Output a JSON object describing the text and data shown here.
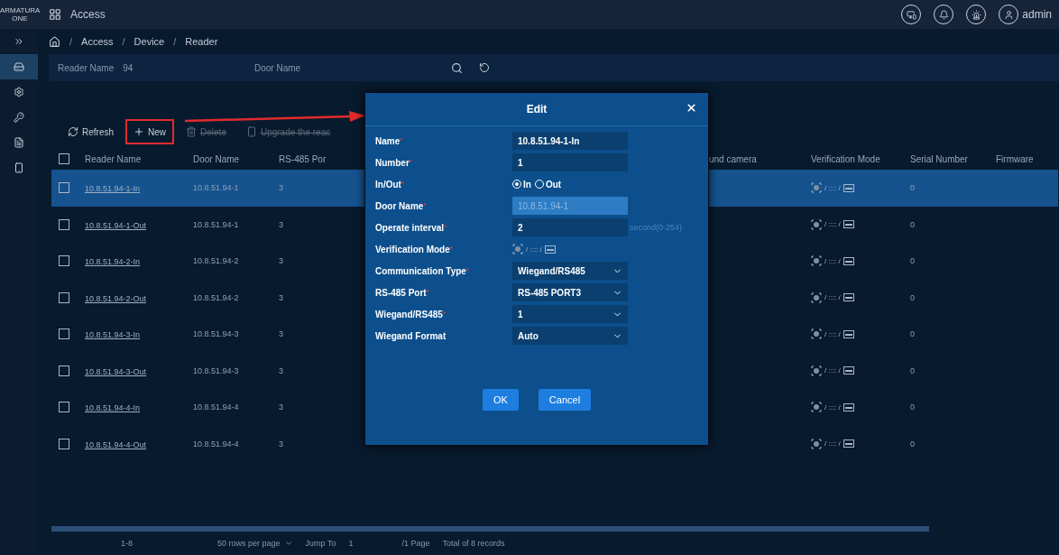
{
  "topbar": {
    "logo": "ARMATURA ONE",
    "app": "Access",
    "user": "admin"
  },
  "sidebar": [
    {
      "selected": false
    },
    {
      "selected": true
    },
    {
      "selected": false
    },
    {
      "selected": false
    },
    {
      "selected": false
    },
    {
      "selected": false
    }
  ],
  "breadcrumb": [
    {
      "kind": "separator",
      "text": "/"
    },
    {
      "kind": "item",
      "text": "Access"
    },
    {
      "kind": "separator",
      "text": "/"
    },
    {
      "kind": "item",
      "text": "Device"
    },
    {
      "kind": "separator",
      "text": "/"
    },
    {
      "kind": "item",
      "text": "Reader"
    }
  ],
  "search": [
    {
      "label": "Reader Name",
      "value": "94"
    },
    {
      "label": "Door Name"
    }
  ],
  "toolbar": [
    {
      "label": "Refresh",
      "highlighted": false,
      "disabled": false
    },
    {
      "label": "New",
      "highlighted": true,
      "disabled": false
    },
    {
      "label": "Delete",
      "highlighted": false,
      "disabled": true
    },
    {
      "label": "Upgrade the reac",
      "highlighted": false,
      "disabled": true
    }
  ],
  "table": {
    "header_checked": false,
    "columns": [
      "Reader Name",
      "Door Name",
      "RS-485 Por",
      "und camera",
      "Verification Mode",
      "Serial Number",
      "Firmware"
    ],
    "rows": [
      {
        "name": "10.8.51.94-1-In",
        "door": "10.8.51.94-1",
        "port": "3",
        "modes": "/ :::: /",
        "serial": "0",
        "selected": true,
        "checked": false
      },
      {
        "name": "10.8.51.94-1-Out",
        "door": "10.8.51.94-1",
        "port": "3",
        "modes": "/ :::: /",
        "serial": "0",
        "selected": false,
        "checked": false
      },
      {
        "name": "10.8.51.94-2-In",
        "door": "10.8.51.94-2",
        "port": "3",
        "modes": "/ :::: /",
        "serial": "0",
        "selected": false,
        "checked": false
      },
      {
        "name": "10.8.51.94-2-Out",
        "door": "10.8.51.94-2",
        "port": "3",
        "modes": "/ :::: /",
        "serial": "0",
        "selected": false,
        "checked": false
      },
      {
        "name": "10.8.51.94-3-In",
        "door": "10.8.51.94-3",
        "port": "3",
        "modes": "/ :::: /",
        "serial": "0",
        "selected": false,
        "checked": false
      },
      {
        "name": "10.8.51.94-3-Out",
        "door": "10.8.51.94-3",
        "port": "3",
        "modes": "/ :::: /",
        "serial": "0",
        "selected": false,
        "checked": false
      },
      {
        "name": "10.8.51.94-4-In",
        "door": "10.8.51.94-4",
        "port": "3",
        "modes": "/ :::: /",
        "serial": "0",
        "selected": false,
        "checked": false
      },
      {
        "name": "10.8.51.94-4-Out",
        "door": "10.8.51.94-4",
        "port": "3",
        "modes": "/ :::: /",
        "serial": "0",
        "selected": false,
        "checked": false
      }
    ]
  },
  "pagination": {
    "range": "1-8",
    "per_page": "50 rows per page",
    "jump_label": "Jump To",
    "page": "1",
    "pages": "/1 Page",
    "total": "Total of 8 records"
  },
  "dialog": {
    "title": "Edit",
    "fields": [
      {
        "kind": "input",
        "label": "Name",
        "mark": "*",
        "value": "10.8.51.94-1-In"
      },
      {
        "kind": "input",
        "label": "Number",
        "mark": "*",
        "value": "1"
      },
      {
        "kind": "radio",
        "label": "In/Out",
        "mark": "*",
        "options": [
          {
            "label": "In",
            "selected": true
          },
          {
            "label": "Out",
            "selected": false
          }
        ]
      },
      {
        "kind": "readonly",
        "label": "Door Name",
        "mark": "*",
        "value": "10.8.51.94-1"
      },
      {
        "kind": "input",
        "label": "Operate interval",
        "mark": "*",
        "value": "2",
        "suffix": "second(0-254)"
      },
      {
        "kind": "modes",
        "label": "Verification Mode",
        "mark": "*",
        "value": "/ :::: /"
      },
      {
        "kind": "select",
        "label": "Communication Type",
        "mark": "*",
        "value": "Wiegand/RS485"
      },
      {
        "kind": "select",
        "label": "RS-485 Port",
        "mark": "*",
        "value": "RS-485 PORT3"
      },
      {
        "kind": "select",
        "label": "Wiegand/RS485",
        "mark": "*",
        "value": "1"
      },
      {
        "kind": "select",
        "label": "Wiegand Format",
        "value": "Auto"
      }
    ],
    "buttons": [
      {
        "label": "OK",
        "kind": "primary"
      },
      {
        "label": "Cancel",
        "kind": "primary"
      }
    ]
  }
}
